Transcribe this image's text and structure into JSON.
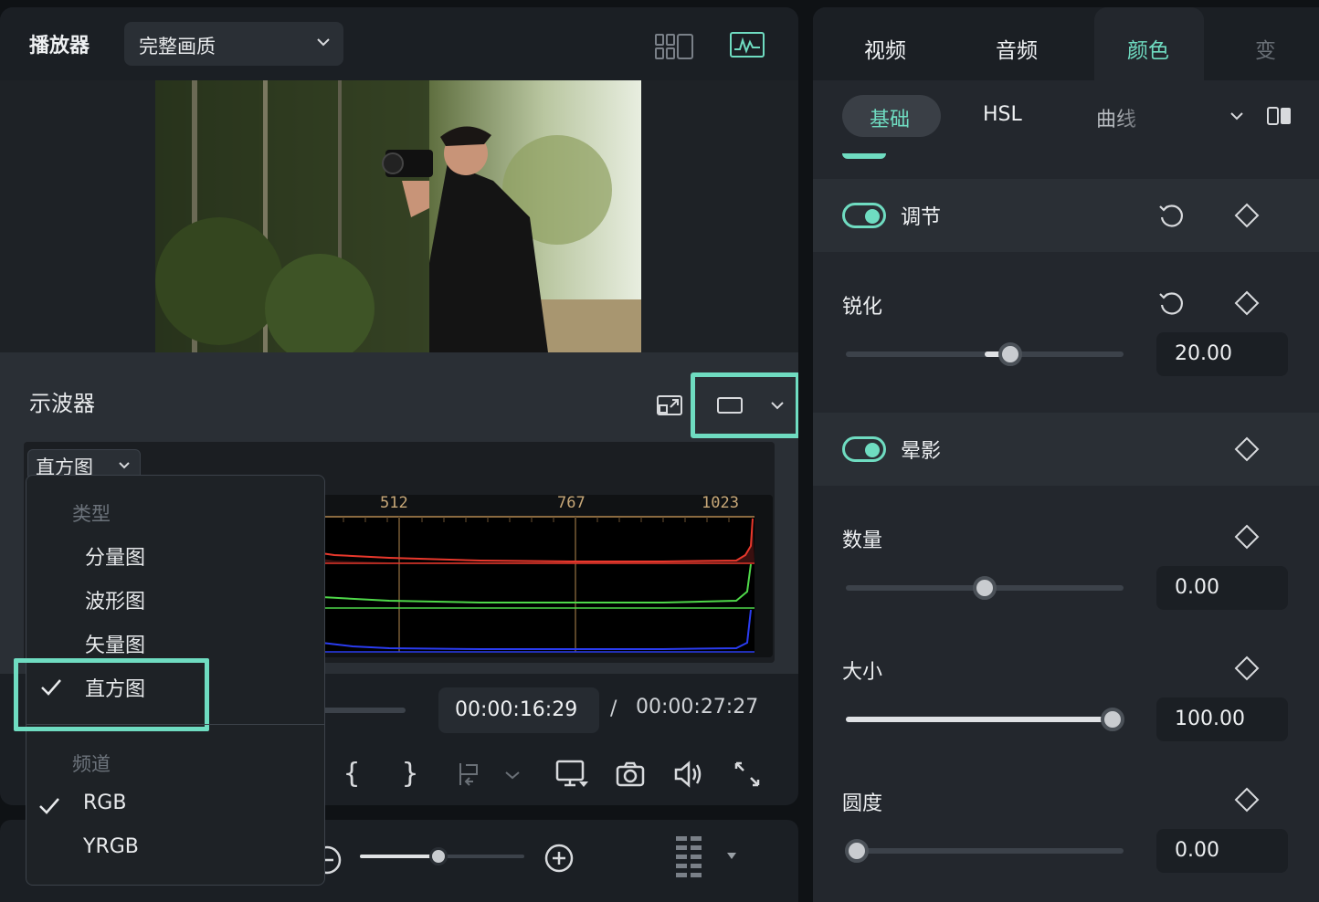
{
  "player": {
    "title": "播放器",
    "quality": "完整画质",
    "icons": [
      "grid-view-icon",
      "waveform-icon"
    ]
  },
  "scope": {
    "title": "示波器",
    "type_selected": "直方图",
    "histogram_ticks": [
      "512",
      "767",
      "1023"
    ],
    "channel_colors": {
      "red": "#e8382c",
      "green": "#4fd84a",
      "blue": "#2a3cf0"
    }
  },
  "scope_menu": {
    "type_header": "类型",
    "types": [
      {
        "label": "分量图",
        "checked": false
      },
      {
        "label": "波形图",
        "checked": false
      },
      {
        "label": "矢量图",
        "checked": false
      },
      {
        "label": "直方图",
        "checked": true
      }
    ],
    "channel_header": "频道",
    "channels": [
      {
        "label": "RGB",
        "checked": true
      },
      {
        "label": "YRGB",
        "checked": false
      }
    ]
  },
  "transport": {
    "current_time": "00:00:16:29",
    "separator": "/",
    "total_time": "00:00:27:27",
    "mark_in": "{",
    "mark_out": "}"
  },
  "right_panel": {
    "tabs": [
      "视频",
      "音频",
      "颜色",
      "变"
    ],
    "active_tab": "颜色",
    "subtabs": [
      "基础",
      "HSL",
      "曲线"
    ],
    "active_subtab": "基础",
    "adjust": {
      "label": "调节",
      "enabled": true,
      "sharpen": {
        "label": "锐化",
        "value": "20.00",
        "fraction": 0.6
      }
    },
    "vignette": {
      "label": "晕影",
      "enabled": true,
      "params": [
        {
          "label": "数量",
          "value": "0.00",
          "fraction": 0.5
        },
        {
          "label": "大小",
          "value": "100.00",
          "fraction": 1.0
        },
        {
          "label": "圆度",
          "value": "0.00",
          "fraction": 0.0
        }
      ]
    }
  },
  "colors": {
    "accent": "#6fdcc1"
  }
}
